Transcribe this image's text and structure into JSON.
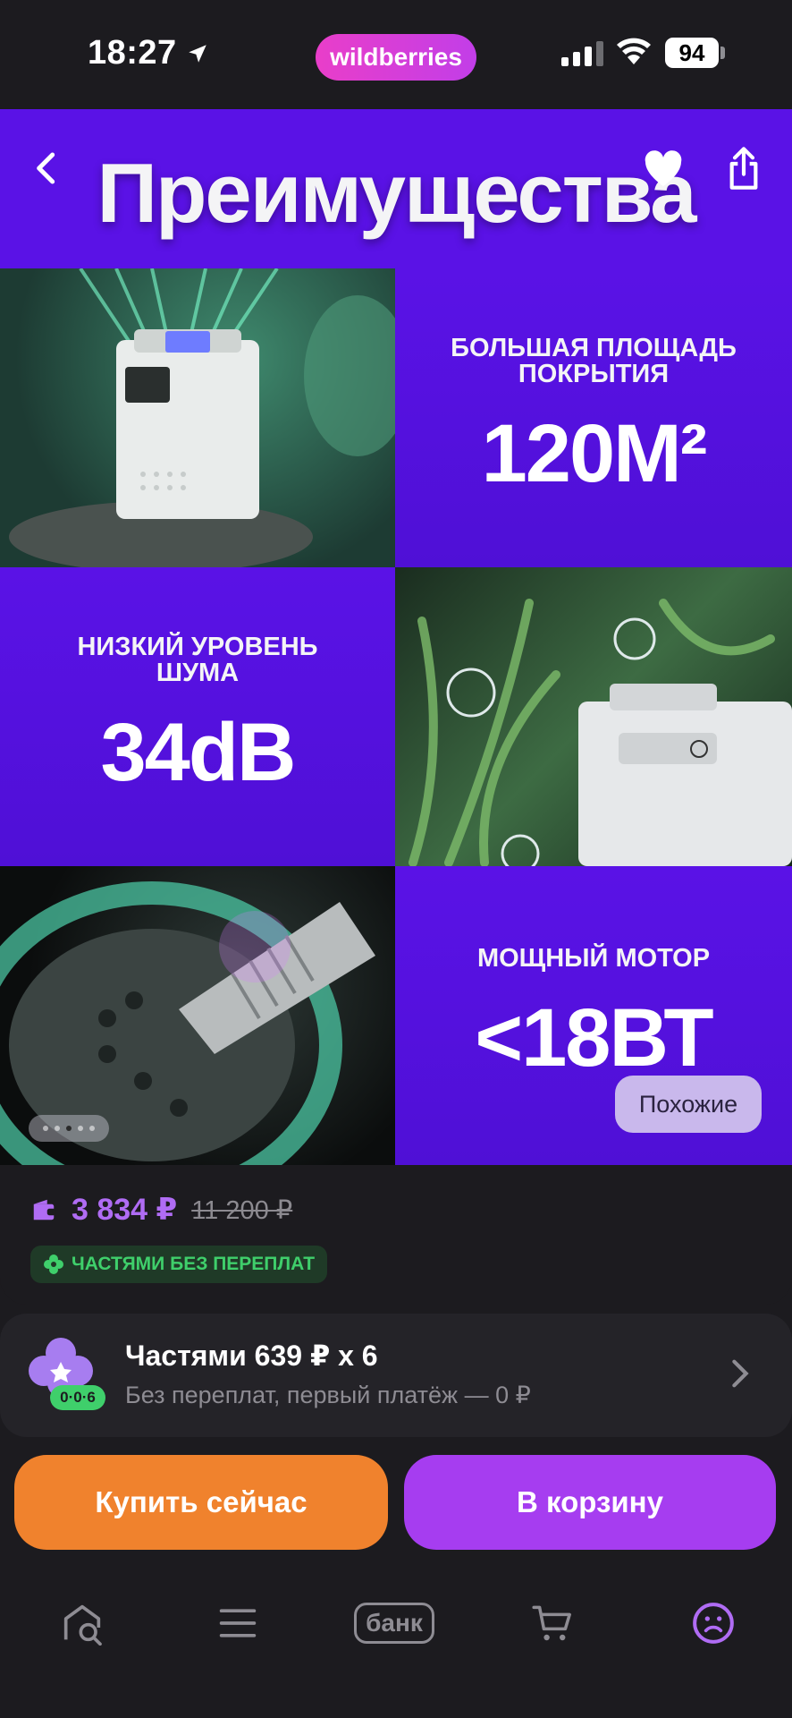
{
  "status_bar": {
    "time": "18:27",
    "brand": "wildberries",
    "battery": "94"
  },
  "hero": {
    "title": "Преимущества",
    "features": [
      {
        "label": "БОЛЬШАЯ ПЛОЩАДЬ ПОКРЫТИЯ",
        "value": "120М²"
      },
      {
        "label": "НИЗКИЙ УРОВЕНЬ ШУМА",
        "value": "34dB"
      },
      {
        "label": "МОЩНЫЙ МОТОР",
        "value": "<18ВТ"
      }
    ],
    "similar_label": "Похожие",
    "pager_total": 5,
    "pager_active": 3
  },
  "price": {
    "current": "3 834 ₽",
    "old": "11 200 ₽",
    "badge": "ЧАСТЯМИ БЕЗ ПЕРЕПЛАТ"
  },
  "installments": {
    "title": "Частями 639 ₽ x 6",
    "subtitle": "Без переплат, первый платёж — 0 ₽",
    "chip": "0·0·6"
  },
  "actions": {
    "buy_now": "Купить сейчас",
    "add_to_cart": "В корзину"
  },
  "tabbar": {
    "bank_label": "банк",
    "items": [
      "home-search-icon",
      "menu-icon",
      "bank-icon",
      "cart-icon",
      "profile-icon"
    ]
  },
  "colors": {
    "accent_purple": "#a63df0",
    "buy_orange": "#f0822d",
    "price_purple": "#b06cf4",
    "installment_green": "#3fcf6b",
    "hero_purple": "#5a12e6"
  }
}
